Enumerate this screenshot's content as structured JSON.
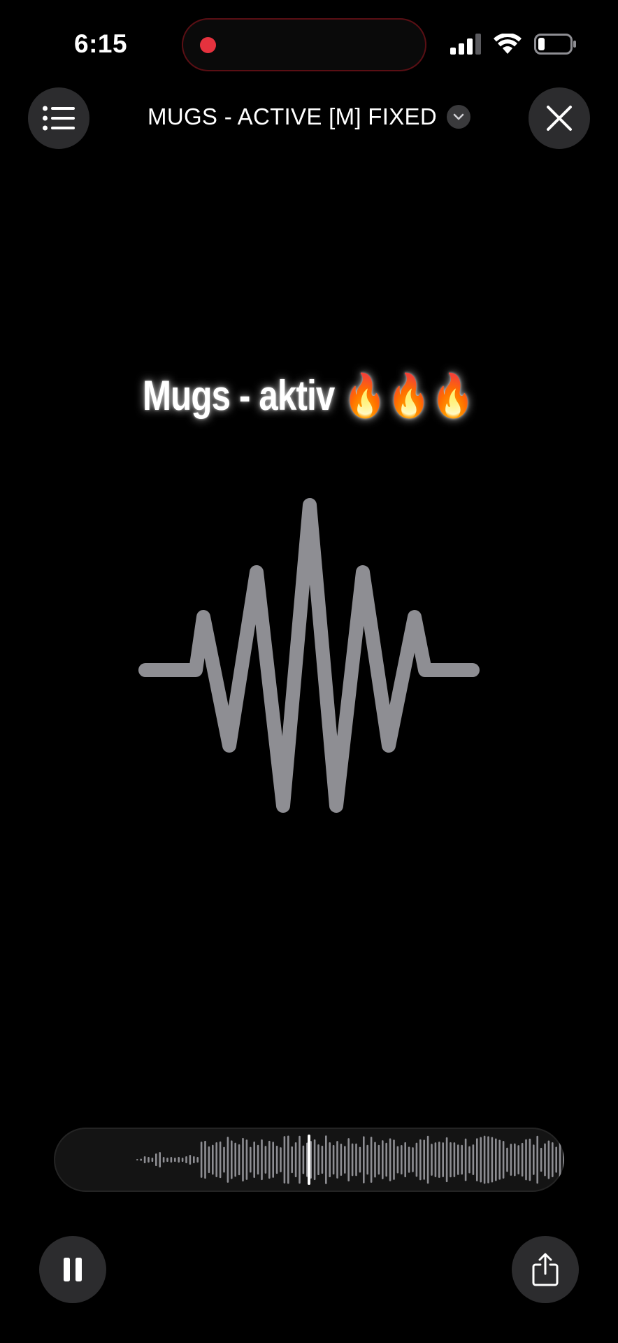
{
  "status_bar": {
    "time": "6:15",
    "recording_indicator": "red-dot",
    "signal_icon": "cellular-signal-icon",
    "wifi_icon": "wifi-icon",
    "battery_icon": "battery-icon"
  },
  "header": {
    "title": "MUGS - ACTIVE [M] FIXED",
    "menu_icon": "list-icon",
    "dropdown_icon": "chevron-down-icon",
    "close_icon": "close-icon"
  },
  "caption": {
    "text": "Mugs - aktiv",
    "emoji": "🔥🔥🔥"
  },
  "player": {
    "center_icon": "waveform-icon",
    "scrubber_icon": "audio-waveform-scrubber",
    "pause_icon": "pause-icon",
    "share_icon": "share-icon"
  },
  "colors": {
    "background": "#000000",
    "button": "#2c2c2e",
    "wave": "#8e8e93",
    "record": "#e5323e"
  }
}
